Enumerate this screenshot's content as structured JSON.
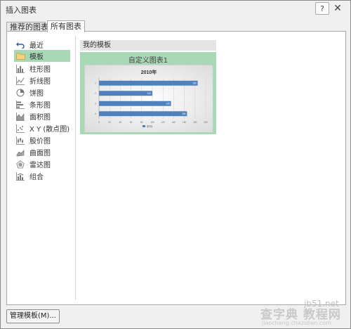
{
  "window": {
    "title": "插入图表",
    "help_label": "?",
    "close_label": "✕"
  },
  "tabs": [
    {
      "label": "推荐的图表",
      "selected": false
    },
    {
      "label": "所有图表",
      "selected": true
    }
  ],
  "sidebar": {
    "items": [
      {
        "label": "最近",
        "icon": "undo-arrow-icon"
      },
      {
        "label": "模板",
        "icon": "folder-icon",
        "selected": true
      },
      {
        "label": "柱形图",
        "icon": "column-chart-icon"
      },
      {
        "label": "折线图",
        "icon": "line-chart-icon"
      },
      {
        "label": "饼图",
        "icon": "pie-chart-icon"
      },
      {
        "label": "条形图",
        "icon": "bar-chart-icon"
      },
      {
        "label": "面积图",
        "icon": "area-chart-icon"
      },
      {
        "label": "X Y (散点图)",
        "icon": "scatter-chart-icon"
      },
      {
        "label": "股价图",
        "icon": "stock-chart-icon"
      },
      {
        "label": "曲面图",
        "icon": "surface-chart-icon"
      },
      {
        "label": "雷达图",
        "icon": "radar-chart-icon"
      },
      {
        "label": "组合",
        "icon": "combo-chart-icon"
      }
    ]
  },
  "content": {
    "section_title": "我的模板",
    "template_name": "自定义图表1"
  },
  "chart_data": {
    "type": "bar",
    "title": "2010年",
    "categories": [
      "1",
      "2",
      "3",
      "4"
    ],
    "values": [
      185,
      100,
      135,
      165
    ],
    "data_labels": [
      "185",
      "100",
      "135",
      "165"
    ],
    "xlim": [
      0,
      200
    ],
    "xticks": [
      "0",
      "20",
      "40",
      "60",
      "80",
      "100",
      "120",
      "140",
      "160",
      "180",
      "200"
    ],
    "legend_label": "系列1",
    "bar_color": "#4f81bd"
  },
  "footer": {
    "manage_button": "管理模板(M)..."
  },
  "watermark": {
    "main": "查字典 教程网",
    "site": "jb51.net",
    "url": "jiaocheng.chazidian.com"
  }
}
